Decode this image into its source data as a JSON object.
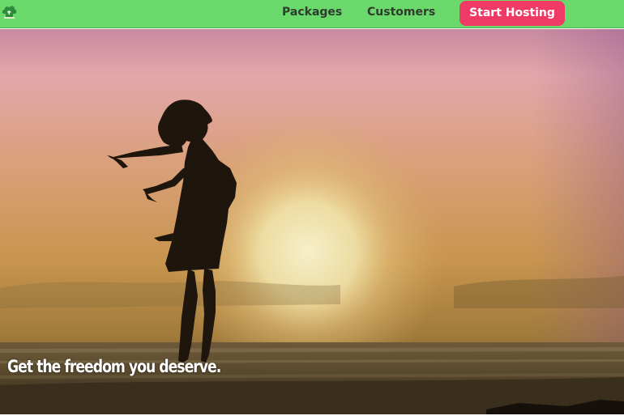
{
  "navbar": {
    "logo_icon": "cloud-house-logo-icon",
    "links": [
      {
        "label": "Packages"
      },
      {
        "label": "Customers"
      }
    ],
    "cta_label": "Start Hosting",
    "colors": {
      "bar": "#6ad86a",
      "cta": "#ee3a64",
      "link_text": "#2f3b2f"
    }
  },
  "hero": {
    "image_subject": "silhouette-woman-sunset-beach",
    "headline": "Get the freedom you deserve."
  }
}
